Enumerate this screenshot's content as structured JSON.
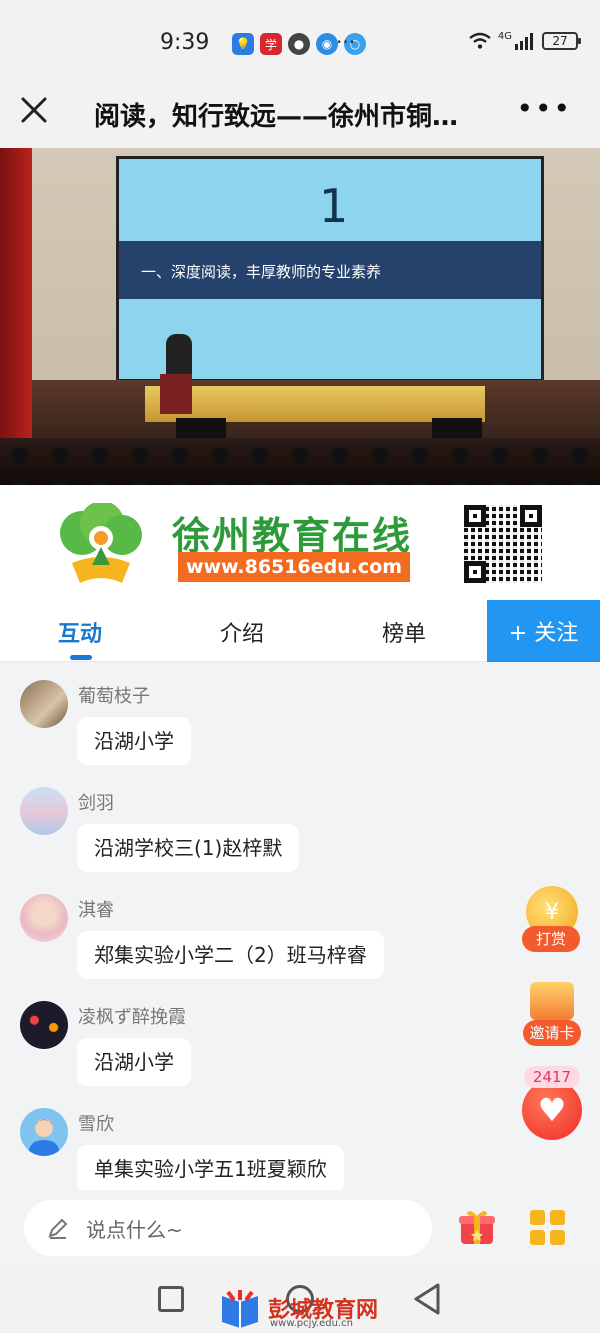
{
  "status_bar": {
    "time": "9:39",
    "network": "4G",
    "battery": "27",
    "more_glyph": "···"
  },
  "header": {
    "title": "阅读，知行致远——徐州市铜…",
    "more_glyph": "•••"
  },
  "video": {
    "slide_number": "1",
    "slide_heading": "一、深度阅读，丰厚教师的专业素养"
  },
  "banner": {
    "brand_name": "徐州教育在线",
    "brand_url": "www.86516edu.com"
  },
  "tabs": {
    "items": [
      {
        "label": "互动",
        "active": true
      },
      {
        "label": "介绍",
        "active": false
      },
      {
        "label": "榜单",
        "active": false
      }
    ],
    "follow_label": "+ 关注"
  },
  "chat": {
    "messages": [
      {
        "user": "葡萄枝子",
        "text": "沿湖小学"
      },
      {
        "user": "剑羽",
        "text": "沿湖学校三(1)赵梓默"
      },
      {
        "user": "淇睿",
        "text": "郑集实验小学二（2）班马梓睿"
      },
      {
        "user": "凌枫ず醉挽霞",
        "text": "沿湖小学"
      },
      {
        "user": "雪欣",
        "text": "单集实验小学五1班夏颖欣"
      }
    ]
  },
  "widgets": {
    "reward_label": "打赏",
    "reward_symbol": "¥",
    "invite_label": "邀请卡",
    "like_count": "2417"
  },
  "input_bar": {
    "placeholder": "说点什么~"
  },
  "watermark": {
    "text": "彭城教育网",
    "url": "www.pcjy.edu.cn"
  },
  "colors": {
    "accent": "#1976d2",
    "follow_button": "#2196f3",
    "brand_green": "#2f9a3a",
    "brand_orange": "#f26b21",
    "reward_orange": "#f35a2d",
    "like_red": "#f0292a"
  }
}
